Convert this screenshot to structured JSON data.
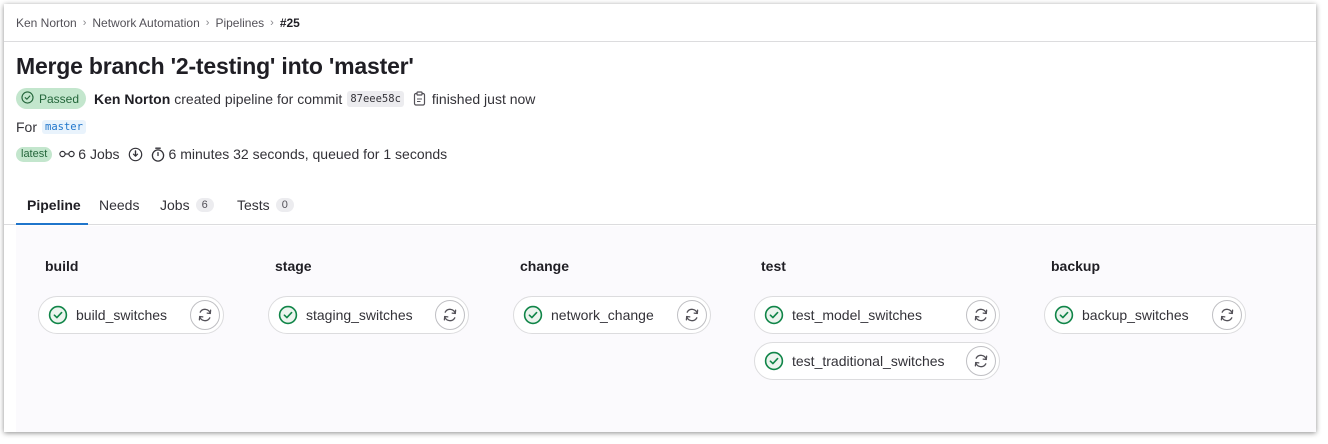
{
  "breadcrumb": {
    "items": [
      "Ken Norton",
      "Network Automation",
      "Pipelines"
    ],
    "current": "#25"
  },
  "title": "Merge branch '2-testing' into 'master'",
  "status": {
    "label": "Passed",
    "color": "#24663b",
    "background": "#c3e6cd"
  },
  "meta": {
    "author": "Ken Norton",
    "created_text": "created pipeline for commit",
    "commit": "87eee58c",
    "finished_text": "finished just now"
  },
  "ref": {
    "prefix": "For",
    "branch": "master"
  },
  "stats": {
    "latest_label": "latest",
    "jobs_text": "6 Jobs",
    "duration_text": "6 minutes 32 seconds, queued for 1 seconds"
  },
  "tabs": [
    {
      "label": "Pipeline",
      "active": true
    },
    {
      "label": "Needs"
    },
    {
      "label": "Jobs",
      "count": "6"
    },
    {
      "label": "Tests",
      "count": "0"
    }
  ],
  "stages": [
    {
      "name": "build",
      "jobs": [
        "build_switches"
      ]
    },
    {
      "name": "stage",
      "jobs": [
        "staging_switches"
      ]
    },
    {
      "name": "change",
      "jobs": [
        "network_change"
      ]
    },
    {
      "name": "test",
      "jobs": [
        "test_model_switches",
        "test_traditional_switches"
      ]
    },
    {
      "name": "backup",
      "jobs": [
        "backup_switches"
      ]
    }
  ],
  "icons": {
    "status": "check-circle-icon",
    "retry": "retry-icon",
    "copy": "clipboard-icon",
    "jobs": "pipeline-icon",
    "info": "info-icon",
    "timer": "timer-icon"
  },
  "colors": {
    "accent": "#1f75cb",
    "success": "#108548"
  }
}
